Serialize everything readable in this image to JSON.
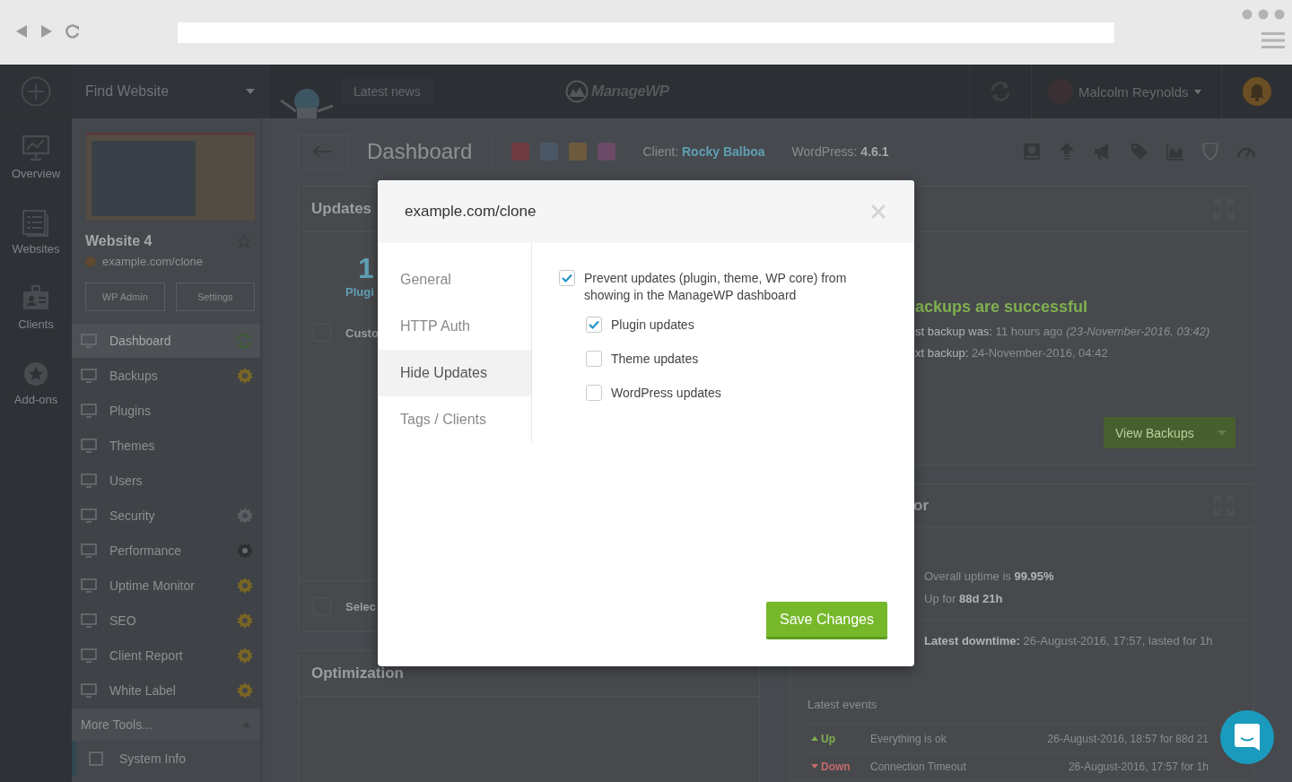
{
  "rail": [
    {
      "label": "Overview",
      "kind": "chart"
    },
    {
      "label": "Websites",
      "kind": "list"
    },
    {
      "label": "Clients",
      "kind": "badge"
    },
    {
      "label": "Add-ons",
      "kind": "star"
    }
  ],
  "topbar": {
    "search_label": "Find Website",
    "news": "Latest news",
    "logo": "ManageWP",
    "user": "Malcolm Reynolds"
  },
  "website": {
    "name": "Website 4",
    "url": "example.com/clone",
    "buttons": [
      "WP Admin",
      "Settings"
    ],
    "menu": [
      {
        "label": "Dashboard",
        "kind": "sync",
        "selected": true
      },
      {
        "label": "Backups",
        "kind": "addon",
        "selected": false
      },
      {
        "label": "Plugins",
        "kind": "plain",
        "selected": false
      },
      {
        "label": "Themes",
        "kind": "plain",
        "selected": false
      },
      {
        "label": "Users",
        "kind": "plain",
        "selected": false
      },
      {
        "label": "Security",
        "kind": "inactive",
        "selected": false
      },
      {
        "label": "Performance",
        "kind": "premium",
        "selected": false
      },
      {
        "label": "Uptime Monitor",
        "kind": "addon",
        "selected": false
      },
      {
        "label": "SEO",
        "kind": "addon",
        "selected": false
      },
      {
        "label": "Client Report",
        "kind": "addon",
        "selected": false
      },
      {
        "label": "White Label",
        "kind": "addon",
        "selected": false
      }
    ],
    "more_tools": "More Tools...",
    "submenu": [
      "System Info"
    ]
  },
  "header": {
    "title": "Dashboard",
    "tags": [
      {
        "color": "#6e3c40"
      },
      {
        "color": "#4a5866"
      },
      {
        "color": "#6e5a3e"
      },
      {
        "color": "#6a4a66"
      }
    ],
    "client": "Client: **Rocky Balboa**",
    "wordpress": "WordPress: **4.6.1**"
  },
  "updates_card": {
    "title": "Updates",
    "count": "1",
    "count_label": "Plugi",
    "row": {
      "label": "Custo",
      "checked": false
    },
    "footer": {
      "label": "Selec",
      "checked": false
    }
  },
  "optimization_card": {
    "title": "Optimization"
  },
  "backups_card": {
    "status": "ackups are successful",
    "last": "**st backup was:** 11 hours ago *(23-November-2016, 03:42)*",
    "next": "**xt backup:** 24-November-2016, 04:42",
    "button": "View Backups"
  },
  "uptime_card": {
    "title": "or",
    "overall": "Overall uptime is **99.95%**",
    "up_for": "Up for **88d 21h**",
    "downtime": "**Latest downtime:** 26-August-2016, 17:57, lasted for 1h",
    "events_title": "Latest events",
    "events": [
      {
        "kind": "up",
        "status": "Up",
        "message": "Everything is ok",
        "time": "26-August-2016, 18:57 for 88d 21"
      },
      {
        "kind": "down",
        "status": "Down",
        "message": "Connection Timeout",
        "time": "26-August-2016, 17:57 for 1h"
      }
    ]
  },
  "modal": {
    "title": "example.com/clone",
    "nav": [
      {
        "label": "General",
        "selected": false
      },
      {
        "label": "HTTP Auth",
        "selected": false
      },
      {
        "label": "Hide Updates",
        "selected": true
      },
      {
        "label": "Tags / Clients",
        "selected": false
      }
    ],
    "options": [
      {
        "label": "Prevent updates (plugin, theme, WP core) from showing in the ManageWP dashboard",
        "checked": true,
        "children": [
          {
            "label": "Plugin updates",
            "checked": true
          },
          {
            "label": "Theme updates",
            "checked": false
          },
          {
            "label": "WordPress updates",
            "checked": false
          }
        ]
      }
    ],
    "save_button": "Save Changes"
  }
}
